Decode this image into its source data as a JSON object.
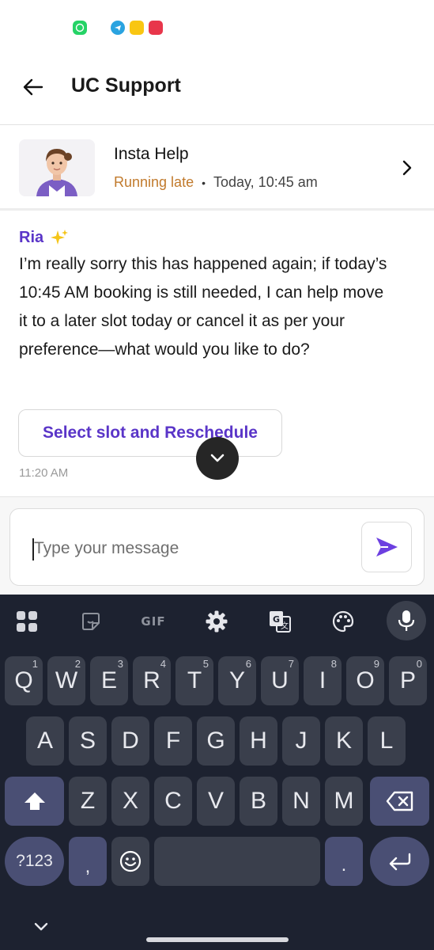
{
  "header": {
    "title": "UC Support"
  },
  "booking": {
    "title": "Insta Help",
    "status": "Running late",
    "separator": "•",
    "time": "Today, 10:45 am"
  },
  "chat": {
    "sender": "Ria",
    "message": "I’m really sorry this has happened again; if today’s 10:45 AM booking is still needed, I can help move it to a later slot today or cancel it as per your preference—what would you like to do?",
    "action_label": "Select slot and Reschedule",
    "timestamp": "11:20 AM"
  },
  "composer": {
    "placeholder": "Type your message"
  },
  "keyboard": {
    "toolbar": {
      "gif_label": "GIF"
    },
    "row1": [
      {
        "key": "Q",
        "sup": "1"
      },
      {
        "key": "W",
        "sup": "2"
      },
      {
        "key": "E",
        "sup": "3"
      },
      {
        "key": "R",
        "sup": "4"
      },
      {
        "key": "T",
        "sup": "5"
      },
      {
        "key": "Y",
        "sup": "6"
      },
      {
        "key": "U",
        "sup": "7"
      },
      {
        "key": "I",
        "sup": "8"
      },
      {
        "key": "O",
        "sup": "9"
      },
      {
        "key": "P",
        "sup": "0"
      }
    ],
    "row2": [
      "A",
      "S",
      "D",
      "F",
      "G",
      "H",
      "J",
      "K",
      "L"
    ],
    "row3": [
      "Z",
      "X",
      "C",
      "V",
      "B",
      "N",
      "M"
    ],
    "symbols_label": "?123",
    "comma_label": ",",
    "period_label": "."
  },
  "colors": {
    "accent": "#5a35c8",
    "status_late": "#c17a2c",
    "keyboard_bg": "#1d2230"
  }
}
